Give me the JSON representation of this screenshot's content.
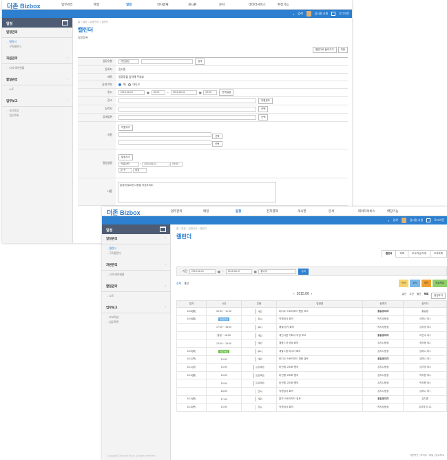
{
  "app": {
    "logo_main": "더존",
    "logo_sub": "Bizbox"
  },
  "gnb_menu": [
    "업무관리",
    "메일",
    "일정",
    "전자결재",
    "게시판",
    "문서",
    "데이터서비스",
    "확장기능"
  ],
  "gnb_active": "일정",
  "topbar": {
    "search": "검색",
    "user": "김사원 사원",
    "logout": "로그아웃"
  },
  "sidebar": {
    "title": "일정",
    "sections": [
      {
        "label": "일정관리",
        "items": [
          "캘린더",
          "구독캘린더"
        ]
      },
      {
        "label": "자원관리",
        "items": [
          "나의 예약현황"
        ]
      },
      {
        "label": "할일관리",
        "items": [
          "노트"
        ]
      },
      {
        "label": "업무보고",
        "items": [
          "보고작성",
          "업무목록"
        ]
      }
    ]
  },
  "form_page": {
    "breadcrumb": "홈 > 일정 > 일정관리 > 캘린더",
    "title": "캘린더",
    "subtitle": "일정등록",
    "buttons": [
      "캘린더로 돌아가기",
      "저장"
    ],
    "rows": [
      {
        "label": "일정유형",
        "value": "개인일정"
      },
      {
        "label": "등록자",
        "value": "김사원"
      },
      {
        "label": "제목",
        "value": "일정명을 입력해 주세요"
      },
      {
        "label": "공개 여부",
        "value": "예"
      },
      {
        "label": "일시",
        "value": "2015-06-01"
      },
      {
        "label": "장소",
        "value": ""
      },
      {
        "label": "참석자",
        "value": ""
      },
      {
        "label": "공개범위",
        "value": ""
      },
      {
        "label": "자원",
        "value": "자원추가"
      },
      {
        "label": "알림설정",
        "value": "알림추가"
      },
      {
        "label": "내용",
        "value": "일정에 필요한 내용을 작성하세요."
      }
    ]
  },
  "list_page": {
    "breadcrumb": "홈 > 일정 > 일정관리 > 캘린더",
    "title": "캘린더",
    "tabs": [
      "캘린더",
      "목록",
      "부서/직급/직위",
      "조회목록"
    ],
    "search": {
      "label": "기간",
      "start": "2015-06-01",
      "end": "2015-06-07",
      "keyword": "통나무",
      "button": "검색"
    },
    "filters": [
      "전체",
      "개인"
    ],
    "chips": [
      "전사",
      "부서",
      "개인",
      "프로젝트"
    ],
    "month": "2015.06",
    "views": [
      "일간",
      "주간",
      "월간",
      "목록",
      "일정추가"
    ],
    "columns": [
      "일자",
      "시간",
      "유형",
      "일정명",
      "등록자",
      "참석자"
    ],
    "rows": [
      [
        "6.08(월)",
        "09:00 ~ 11:00",
        "개인",
        "비디오 스토리보드 협업 보고",
        "홍길동대리",
        "홍길동"
      ],
      [
        "6.08(월)",
        "종일일정",
        "전사",
        "직원검사 회의",
        "박지성팀장",
        "이하나 외1"
      ],
      [
        "",
        "17:00 ~ 18:00",
        "부서",
        "매월 정기 회의",
        "박지성팀장",
        "김지영 외4"
      ],
      [
        "",
        "종일 ~ 18:00",
        "개인",
        "개인사업 기획서 작성 보고",
        "홍길동대리",
        "이건수 외1"
      ],
      [
        "",
        "13:00 ~ 15:00",
        "개인",
        "제품 1차 성능 회의",
        "김지나팀장",
        "정지윤 외2"
      ],
      [
        "6.09(화)",
        "하루종일",
        "부서",
        "개발 1팀 미디어 회의",
        "김지나팀장",
        "김하나 외1"
      ],
      [
        "6.11(목)",
        "13:00",
        "개인",
        "비디오 스토리보드 최종 검토",
        "홍길동대리",
        "김하나 외1"
      ],
      [
        "6.12(금)",
        "13:00",
        "프로젝트",
        "비전맵 고도화 협의",
        "김지나팀장",
        "김가영 외3"
      ],
      [
        "6.15(월)",
        "13:00",
        "프로젝트",
        "비전맵 고도화 협의",
        "김지나팀장",
        "박지원 외4"
      ],
      [
        "",
        "15:00",
        "프로젝트",
        "비전맵 고도화 협의",
        "김지나팀장",
        "박지원 외4"
      ],
      [
        "",
        "18:00",
        "전사",
        "직원검사 회의",
        "김지나팀장",
        "김하나 외7"
      ],
      [
        "6.16(화)",
        "17:00",
        "개인",
        "홍보 스토리보드 검토",
        "홍길동대리",
        "김지훈"
      ],
      [
        "6.18(목)",
        "13:00",
        "전사",
        "직원검사 회의",
        "박지성팀장",
        "김다영 외 11"
      ]
    ],
    "type_colors": {
      "개인": "#f0a030",
      "전사": "#f7d36b",
      "부서": "#7ab8e8",
      "프로젝트": "#8fce6a"
    },
    "footer": "Copyright Douzone Bizon. All rights reserved.",
    "footer_links": "이용약관 | 조직도 | 메일 | 업무보고"
  }
}
